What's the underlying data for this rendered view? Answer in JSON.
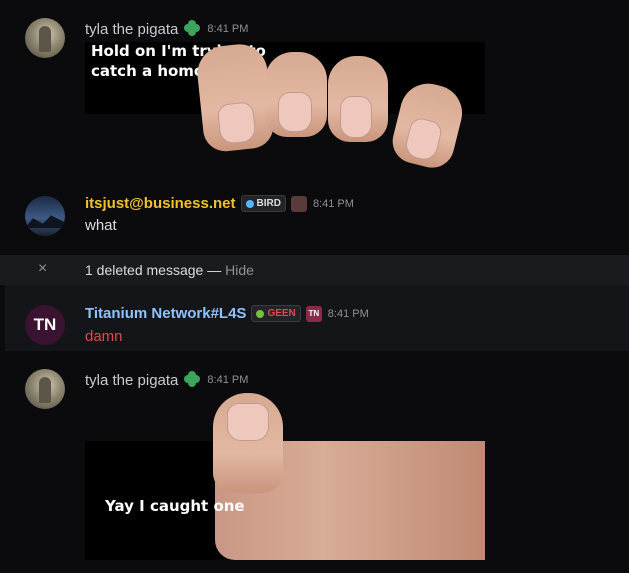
{
  "messages": [
    {
      "username": "tyla the pigata",
      "timestamp": "8:41 PM",
      "meme_caption_1": "Hold on I'm trying to",
      "meme_caption_2": "catch a homosexual"
    },
    {
      "username": "itsjust@business.net",
      "tag": "BIRD",
      "timestamp": "8:41 PM",
      "text": "what"
    },
    {
      "deleted_count_text": "1 deleted message",
      "separator": "—",
      "hide_label": "Hide",
      "close_glyph": "×"
    },
    {
      "avatar_initials": "TN",
      "username": "Titanium Network#L4S",
      "tag": "GEEN",
      "role_icon_text": "TN",
      "timestamp": "8:41 PM",
      "text": "damn"
    },
    {
      "username": "tyla the pigata",
      "timestamp": "8:41 PM",
      "meme_caption": "Yay I caught one"
    }
  ],
  "colors": {
    "background": "#0b0b0d",
    "username_gold": "#f0c12c",
    "username_blue": "#8fc3ff",
    "danger_text": "#e0494e",
    "clover": "#3ba55d"
  },
  "icons": [
    "clover-icon",
    "bird-tag-icon",
    "geen-tag-icon",
    "close-icon"
  ]
}
